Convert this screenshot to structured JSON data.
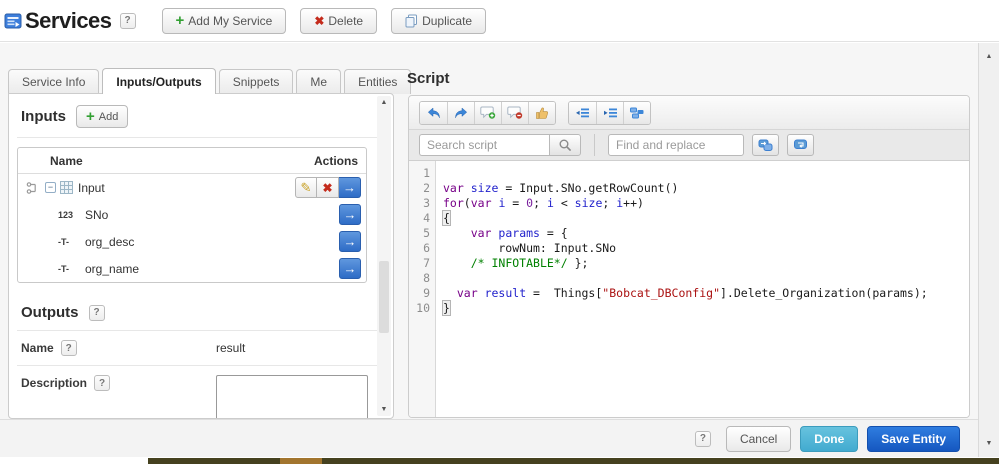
{
  "header": {
    "title": "Services",
    "help": "?",
    "add_service_label": "Add My Service",
    "delete_label": "Delete",
    "duplicate_label": "Duplicate"
  },
  "tabs": [
    {
      "label": "Service Info",
      "active": false
    },
    {
      "label": "Inputs/Outputs",
      "active": true
    },
    {
      "label": "Snippets",
      "active": false
    },
    {
      "label": "Me",
      "active": false
    },
    {
      "label": "Entities",
      "active": false
    }
  ],
  "inputs": {
    "title": "Inputs",
    "add_label": "Add",
    "columns": {
      "name": "Name",
      "actions": "Actions"
    },
    "root_row": {
      "name": "Input"
    },
    "child_rows": [
      {
        "type_icon": "123",
        "name": "SNo"
      },
      {
        "type_icon": "-T-",
        "name": "org_desc"
      },
      {
        "type_icon": "-T-",
        "name": "org_name"
      }
    ]
  },
  "outputs": {
    "title": "Outputs",
    "help": "?",
    "name_label": "Name",
    "name_help": "?",
    "name_value": "result",
    "description_label": "Description",
    "description_help": "?",
    "description_value": ""
  },
  "script": {
    "title": "Script",
    "toolbar_icons": [
      "undo",
      "redo",
      "add-comment",
      "remove-comment",
      "approve",
      "outdent",
      "indent",
      "reformat-code"
    ],
    "search_placeholder": "Search script",
    "find_replace_placeholder": "Find and replace",
    "code_lines": [
      {
        "num": 1,
        "segments": []
      },
      {
        "num": 2,
        "segments": [
          [
            "kw",
            "var"
          ],
          [
            "pl",
            " "
          ],
          [
            "def",
            "size"
          ],
          [
            "pl",
            " = Input.SNo.getRowCount()"
          ]
        ]
      },
      {
        "num": 3,
        "segments": [
          [
            "kw",
            "for"
          ],
          [
            "pl",
            "("
          ],
          [
            "kw",
            "var"
          ],
          [
            "pl",
            " "
          ],
          [
            "def",
            "i"
          ],
          [
            "pl",
            " = "
          ],
          [
            "num",
            "0"
          ],
          [
            "pl",
            "; "
          ],
          [
            "def",
            "i"
          ],
          [
            "pl",
            " < "
          ],
          [
            "def",
            "size"
          ],
          [
            "pl",
            "; "
          ],
          [
            "def",
            "i"
          ],
          [
            "pl",
            "++)"
          ]
        ]
      },
      {
        "num": 4,
        "segments": [
          [
            "br",
            "{"
          ]
        ]
      },
      {
        "num": 5,
        "segments": [
          [
            "pl",
            "    "
          ],
          [
            "kw",
            "var"
          ],
          [
            "pl",
            " "
          ],
          [
            "def",
            "params"
          ],
          [
            "pl",
            " = {"
          ]
        ]
      },
      {
        "num": 6,
        "segments": [
          [
            "pl",
            "        rowNum: Input.SNo"
          ]
        ]
      },
      {
        "num": 7,
        "segments": [
          [
            "pl",
            "    "
          ],
          [
            "cmt",
            "/* INFOTABLE*/"
          ],
          [
            "pl",
            " };"
          ]
        ]
      },
      {
        "num": 8,
        "segments": []
      },
      {
        "num": 9,
        "segments": [
          [
            "pl",
            "  "
          ],
          [
            "kw",
            "var"
          ],
          [
            "pl",
            " "
          ],
          [
            "def",
            "result"
          ],
          [
            "pl",
            " =  Things["
          ],
          [
            "str",
            "\"Bobcat_DBConfig\""
          ],
          [
            "pl",
            "].Delete_Organization(params);"
          ]
        ]
      },
      {
        "num": 10,
        "segments": [
          [
            "br",
            "}"
          ]
        ]
      }
    ]
  },
  "footer": {
    "help": "?",
    "cancel": "Cancel",
    "done": "Done",
    "save": "Save Entity"
  },
  "colors": {
    "accent_blue": "#3c7fd0",
    "save_button": "#1b5fc9",
    "done_button": "#54b7d8",
    "delete_red": "#c42b1c",
    "add_green": "#33a033",
    "code_keyword": "#770088",
    "code_variable": "#2222cc",
    "code_number": "#7a219e",
    "code_string": "#aa1111",
    "code_comment": "#008000"
  }
}
